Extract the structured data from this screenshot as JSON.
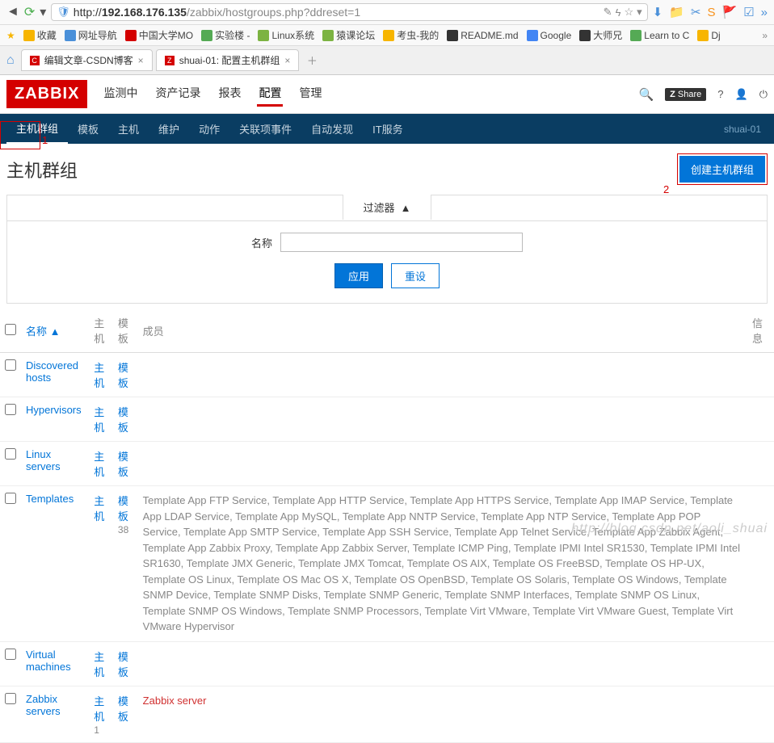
{
  "browser": {
    "url_proto": "http://",
    "url_host": "192.168.176.135",
    "url_path": "/zabbix/hostgroups.php?ddreset=1",
    "bookmarks": [
      {
        "label": "收藏",
        "color": "#f7b500"
      },
      {
        "label": "网址导航",
        "color": "#4a90d9"
      },
      {
        "label": "中国大学MO",
        "color": "#d40000"
      },
      {
        "label": "实验楼 -",
        "color": "#55aa55"
      },
      {
        "label": "Linux系统",
        "color": "#7cb342"
      },
      {
        "label": "猿课论坛",
        "color": "#7cb342"
      },
      {
        "label": "考虫-我的",
        "color": "#f7b500"
      },
      {
        "label": "README.md",
        "color": "#333"
      },
      {
        "label": "Google",
        "color": "#4285f4"
      },
      {
        "label": "大师兄",
        "color": "#333"
      },
      {
        "label": "Learn to C",
        "color": "#55aa55"
      },
      {
        "label": "Dj",
        "color": "#f7b500"
      }
    ],
    "tabs": [
      {
        "label": "编辑文章-CSDN博客",
        "icon_color": "#d40000"
      },
      {
        "label": "shuai-01: 配置主机群组",
        "icon_color": "#d40000"
      }
    ]
  },
  "header": {
    "logo": "ZABBIX",
    "nav": [
      "监测中",
      "资产记录",
      "报表",
      "配置",
      "管理"
    ],
    "nav_active": 3,
    "share": "Share",
    "user_label": "shuai-01"
  },
  "subnav": [
    "主机群组",
    "模板",
    "主机",
    "维护",
    "动作",
    "关联项事件",
    "自动发现",
    "IT服务"
  ],
  "subnav_active": 0,
  "page": {
    "title": "主机群组",
    "create_btn": "创建主机群组",
    "filter_label": "过滤器",
    "name_label": "名称",
    "apply": "应用",
    "reset": "重设",
    "annotation1": "1",
    "annotation2": "2"
  },
  "table": {
    "headers": {
      "name": "名称 ▲",
      "hosts": "主机",
      "templates": "模板",
      "members": "成员",
      "info": "信息"
    },
    "rows": [
      {
        "name": "Discovered hosts",
        "hosts": "主机",
        "templates": "模板",
        "hosts_n": "",
        "templates_n": "",
        "members": []
      },
      {
        "name": "Hypervisors",
        "hosts": "主机",
        "templates": "模板",
        "hosts_n": "",
        "templates_n": "",
        "members": []
      },
      {
        "name": "Linux servers",
        "hosts": "主机",
        "templates": "模板",
        "hosts_n": "",
        "templates_n": "",
        "members": []
      },
      {
        "name": "Templates",
        "hosts": "主机",
        "templates": "模板",
        "hosts_n": "",
        "templates_n": "38",
        "members": [
          "Template App FTP Service",
          "Template App HTTP Service",
          "Template App HTTPS Service",
          "Template App IMAP Service",
          "Template App LDAP Service",
          "Template App MySQL",
          "Template App NNTP Service",
          "Template App NTP Service",
          "Template App POP Service",
          "Template App SMTP Service",
          "Template App SSH Service",
          "Template App Telnet Service",
          "Template App Zabbix Agent",
          "Template App Zabbix Proxy",
          "Template App Zabbix Server",
          "Template ICMP Ping",
          "Template IPMI Intel SR1530",
          "Template IPMI Intel SR1630",
          "Template JMX Generic",
          "Template JMX Tomcat",
          "Template OS AIX",
          "Template OS FreeBSD",
          "Template OS HP-UX",
          "Template OS Linux",
          "Template OS Mac OS X",
          "Template OS OpenBSD",
          "Template OS Solaris",
          "Template OS Windows",
          "Template SNMP Device",
          "Template SNMP Disks",
          "Template SNMP Generic",
          "Template SNMP Interfaces",
          "Template SNMP OS Linux",
          "Template SNMP OS Windows",
          "Template SNMP Processors",
          "Template Virt VMware",
          "Template Virt VMware Guest",
          "Template Virt VMware Hypervisor"
        ]
      },
      {
        "name": "Virtual machines",
        "hosts": "主机",
        "templates": "模板",
        "hosts_n": "",
        "templates_n": "",
        "members": []
      },
      {
        "name": "Zabbix servers",
        "hosts": "主机",
        "templates": "模板",
        "hosts_n": "1",
        "templates_n": "",
        "members": [
          "Zabbix server"
        ],
        "red": true
      }
    ]
  },
  "watermark": "http://blog.csdn.net/aoli_shuai"
}
